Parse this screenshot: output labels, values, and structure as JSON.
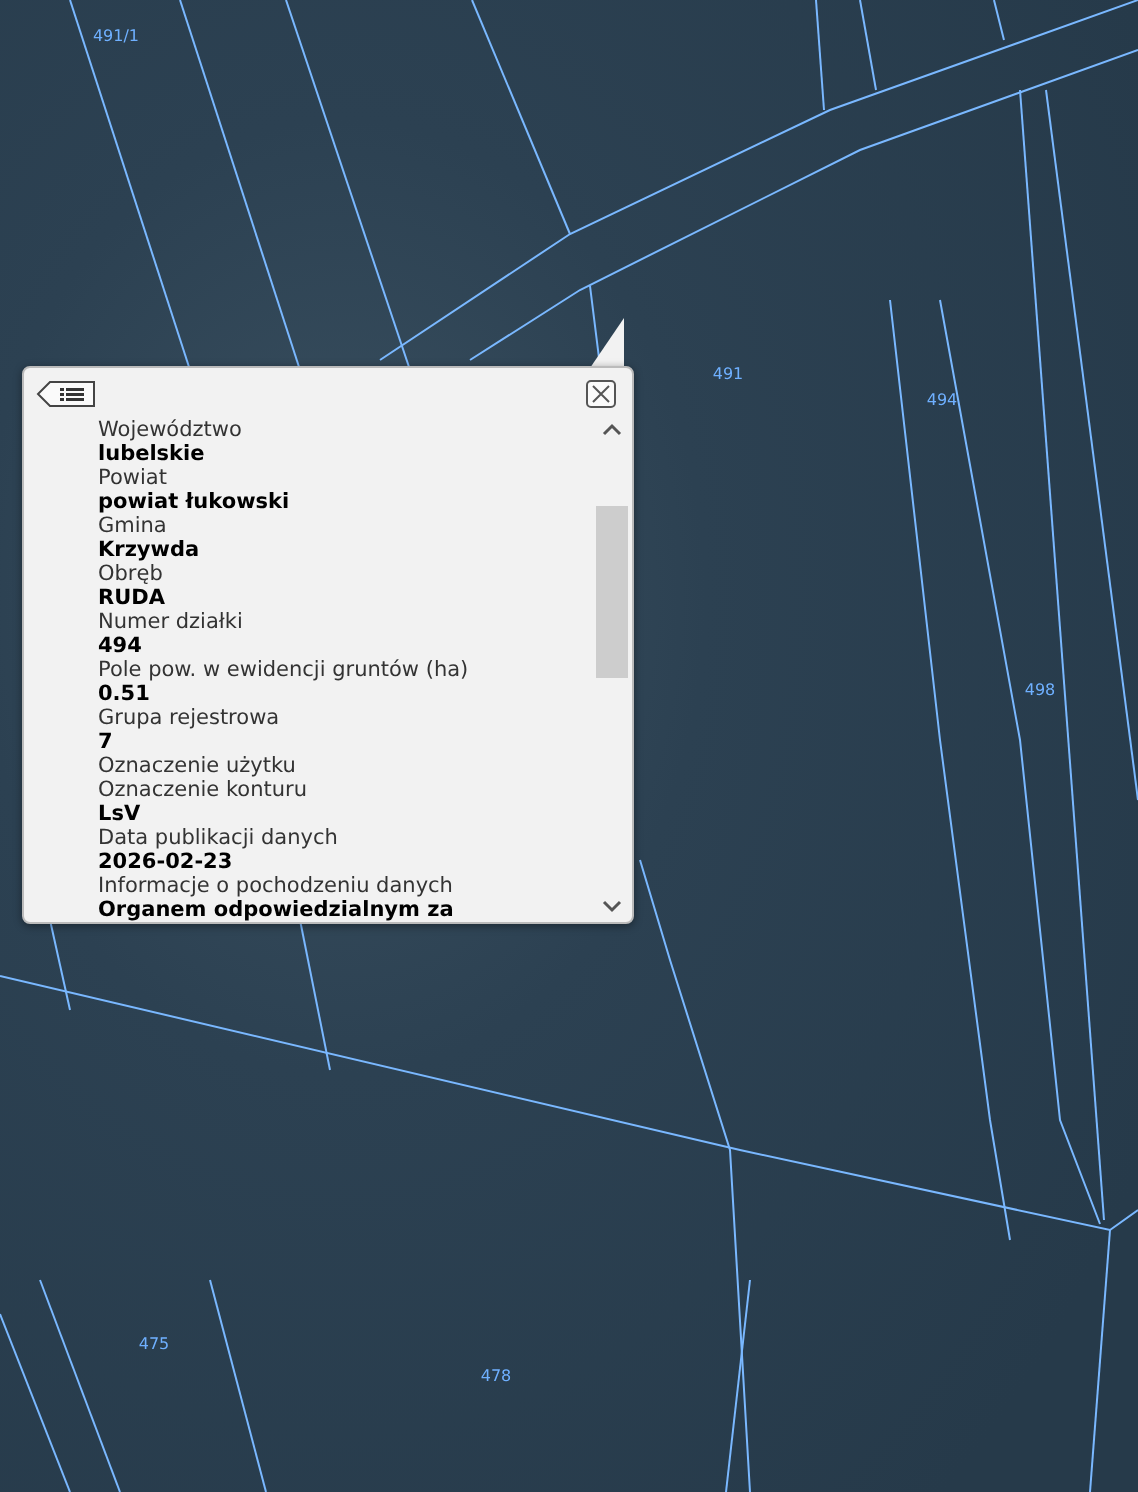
{
  "map": {
    "parcel_labels": [
      {
        "text": "491/1"
      },
      {
        "text": "491"
      },
      {
        "text": "494"
      },
      {
        "text": "498"
      },
      {
        "text": "475"
      },
      {
        "text": "478"
      }
    ]
  },
  "popup": {
    "rows": [
      {
        "kind": "label",
        "text": "Województwo"
      },
      {
        "kind": "value",
        "text": "lubelskie"
      },
      {
        "kind": "label",
        "text": "Powiat"
      },
      {
        "kind": "value",
        "text": "powiat łukowski"
      },
      {
        "kind": "label",
        "text": "Gmina"
      },
      {
        "kind": "value",
        "text": "Krzywda"
      },
      {
        "kind": "label",
        "text": "Obręb"
      },
      {
        "kind": "value",
        "text": "RUDA"
      },
      {
        "kind": "label",
        "text": "Numer działki"
      },
      {
        "kind": "value",
        "text": "494"
      },
      {
        "kind": "label",
        "text": "Pole pow. w ewidencji gruntów (ha)"
      },
      {
        "kind": "value",
        "text": "0.51"
      },
      {
        "kind": "label",
        "text": "Grupa rejestrowa"
      },
      {
        "kind": "value",
        "text": "7"
      },
      {
        "kind": "label",
        "text": "Oznaczenie użytku"
      },
      {
        "kind": "label",
        "text": "Oznaczenie konturu"
      },
      {
        "kind": "value",
        "text": "LsV"
      },
      {
        "kind": "label",
        "text": "Data publikacji danych"
      },
      {
        "kind": "value",
        "text": "2026-02-23"
      },
      {
        "kind": "label",
        "text": "Informacje o pochodzeniu danych"
      },
      {
        "kind": "value",
        "text": "Organem odpowiedzialnym za"
      }
    ]
  }
}
